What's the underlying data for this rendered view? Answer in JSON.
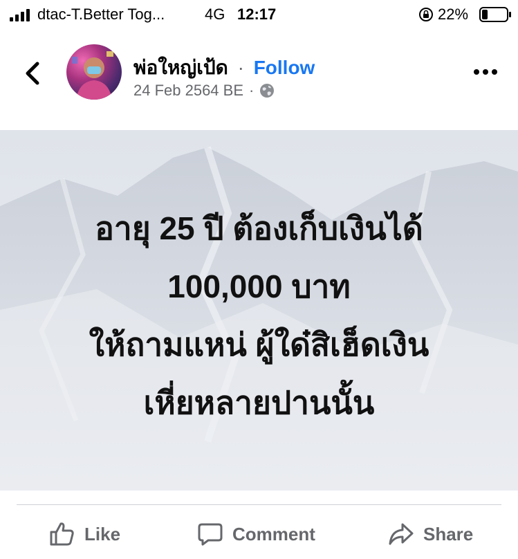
{
  "status_bar": {
    "carrier": "dtac-T.Better Tog...",
    "network": "4G",
    "time": "12:17",
    "battery": "22%"
  },
  "post": {
    "author": "พ่อใหญ่เป้ด",
    "separator": "·",
    "follow_label": "Follow",
    "date": "24 Feb 2564 BE",
    "date_separator": "·",
    "privacy_icon": "globe-icon",
    "text_lines": [
      "อายุ 25 ปี ต้องเก็บเงินได้",
      "100,000 บาท",
      "ให้ถามแหน่ ผู้ใด๋สิเฮ็ดเงิน",
      "เหี่ยหลายปานนั้น"
    ]
  },
  "actions": {
    "like": "Like",
    "comment": "Comment",
    "share": "Share"
  },
  "colors": {
    "follow": "#1877f2",
    "secondary_text": "#65676b",
    "post_background": "#e3e6ec"
  }
}
